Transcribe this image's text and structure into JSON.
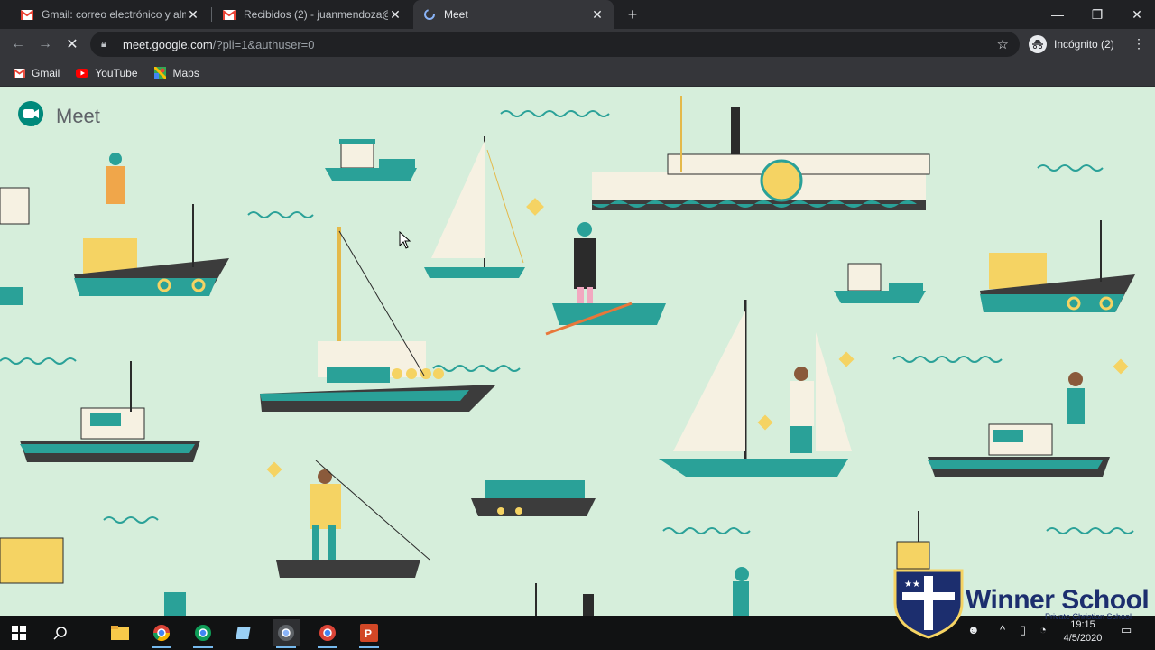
{
  "tabs": [
    {
      "title": "Gmail: correo electrónico y almac",
      "icon": "gmail-icon",
      "active": false
    },
    {
      "title": "Recibidos (2) - juanmendoza@w",
      "icon": "gmail-icon",
      "active": false
    },
    {
      "title": "Meet",
      "icon": "meet-loading-icon",
      "active": true
    }
  ],
  "toolbar": {
    "url_host": "meet.google.com",
    "url_path": "/?pli=1&authuser=0",
    "incognito_label": "Incógnito (2)"
  },
  "bookmarks": [
    {
      "label": "Gmail",
      "icon": "gmail-icon"
    },
    {
      "label": "YouTube",
      "icon": "youtube-icon"
    },
    {
      "label": "Maps",
      "icon": "maps-icon"
    }
  ],
  "page": {
    "app_name": "Meet",
    "background_color": "#d6eedb"
  },
  "watermark": {
    "title": "Winner School",
    "subtitle": "Private Christian School"
  },
  "taskbar": {
    "time": "19:15",
    "date": "4/5/2020"
  }
}
